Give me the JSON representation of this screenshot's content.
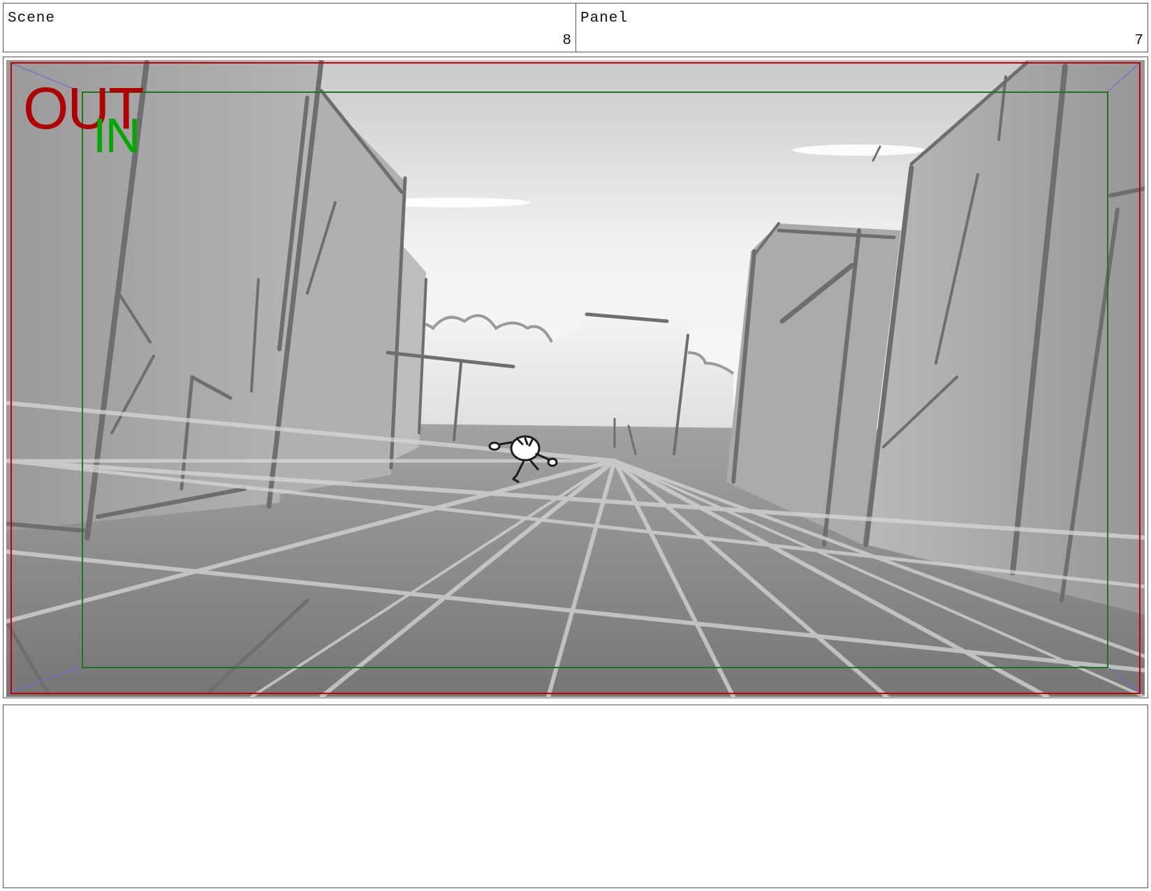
{
  "header": {
    "scene_label": "Scene",
    "scene_number": "8",
    "panel_label": "Panel",
    "panel_number": "7"
  },
  "frame": {
    "out_label": "OUT",
    "in_label": "IN",
    "out_color": "#b00000",
    "in_color": "#00a800",
    "out_border_color": "#c00000",
    "in_border_color": "#1a7a1a",
    "camera_guide_color": "#6a6ad8"
  },
  "notes": {
    "text": ""
  }
}
